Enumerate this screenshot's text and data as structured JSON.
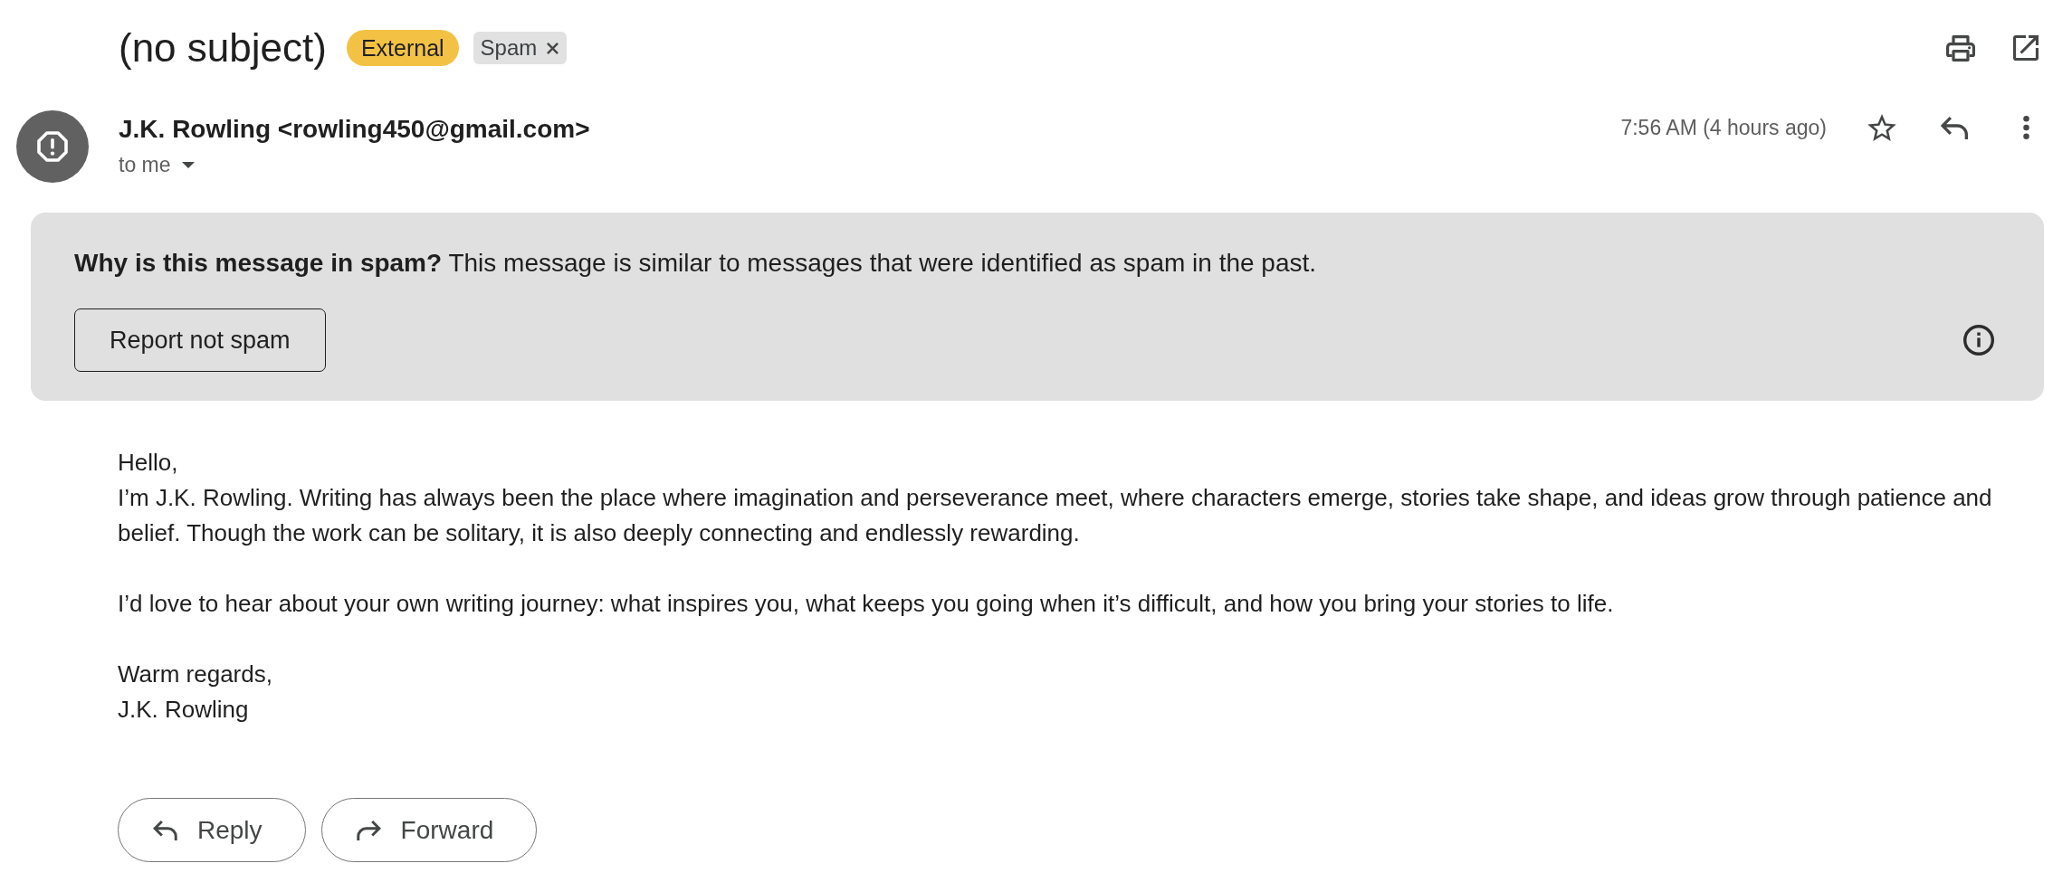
{
  "message": {
    "subject": "(no subject)",
    "labels": [
      {
        "kind": "badge",
        "text": "External",
        "color": "#f3c245"
      },
      {
        "kind": "chip",
        "text": "Spam",
        "color": "#e1e1e1",
        "removable": true
      }
    ]
  },
  "sender": {
    "from": "J.K. Rowling <rowling450@gmail.com>",
    "recipients": "to me",
    "time": "7:56 AM (4 hours ago)",
    "starred": false
  },
  "spam_notice": {
    "text": "**Why is this message in spam?** This message is similar to messages that were identified as spam in the past.",
    "button": "Report not spam"
  },
  "body": {
    "paragraphs": [
      [
        "Hello,",
        "I’m J.K. Rowling. Writing has always been the place where imagination and perseverance meet, where characters emerge, stories take shape, and ideas grow through patience and belief. Though the work can be solitary, it is also deeply connecting and endlessly rewarding."
      ],
      [
        "I’d love to hear about your own writing journey: what inspires you, what keeps you going when it’s difficult, and how you bring your stories to life."
      ],
      [
        "Warm regards,",
        "J.K. Rowling"
      ]
    ]
  },
  "actions": [
    {
      "kind": "reply",
      "label": "Reply"
    },
    {
      "kind": "forward",
      "label": "Forward"
    }
  ]
}
